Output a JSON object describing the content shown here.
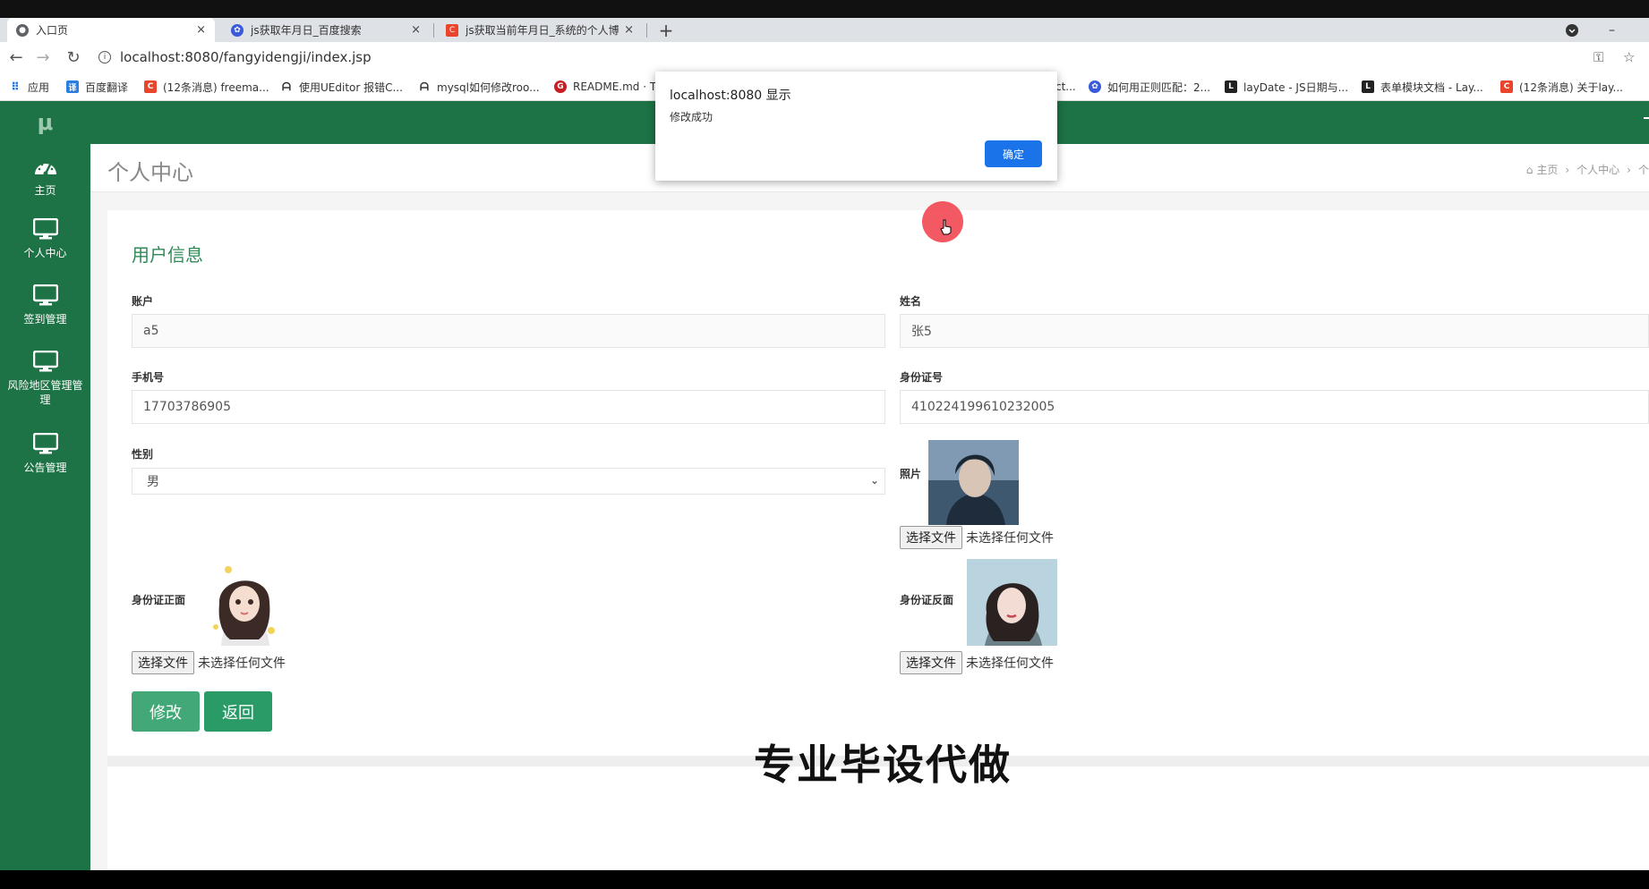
{
  "browser": {
    "tabs": [
      {
        "title": "入口页",
        "icon": "globe-icon",
        "close": "×"
      },
      {
        "title": "js获取年月日_百度搜索",
        "icon": "baidu-paw-icon",
        "close": "×"
      },
      {
        "title": "js获取当前年月日_系统的个人博",
        "icon": "csdn-icon",
        "close": "×"
      }
    ],
    "new_tab": "+",
    "url": "localhost:8080/fangyidengji/index.jsp",
    "bookmarks": [
      {
        "label": "应用",
        "icon": "apps-grid-icon"
      },
      {
        "label": "百度翻译",
        "icon": "translate-icon"
      },
      {
        "label": "(12条消息) freema...",
        "icon": "csdn-icon"
      },
      {
        "label": "使用UEditor 报错C...",
        "icon": "github-icon"
      },
      {
        "label": "mysql如何修改roo...",
        "icon": "github-icon"
      },
      {
        "label": "README.md · T",
        "icon": "gitee-icon"
      },
      {
        "label": "ct...",
        "icon": "link-icon"
      },
      {
        "label": "如何用正则匹配：2...",
        "icon": "baidu-paw-icon"
      },
      {
        "label": "layDate - JS日期与...",
        "icon": "layui-icon"
      },
      {
        "label": "表单模块文档 - Lay...",
        "icon": "layui-icon"
      },
      {
        "label": "(12条消息) 关于lay...",
        "icon": "csdn-icon"
      }
    ]
  },
  "app": {
    "logo": "μ",
    "sidebar": [
      {
        "label": "主页",
        "icon": "dashboard-gauge-icon"
      },
      {
        "label": "个人中心",
        "icon": "monitor-icon"
      },
      {
        "label": "签到管理",
        "icon": "monitor-icon"
      },
      {
        "label": "风险地区管理管理",
        "icon": "monitor-icon"
      },
      {
        "label": "公告管理",
        "icon": "monitor-icon"
      }
    ],
    "page_title": "个人中心",
    "breadcrumb": [
      "主页",
      "个人中心",
      "个"
    ],
    "section_title": "用户信息",
    "form": {
      "account_label": "账户",
      "account_value": "a5",
      "name_label": "姓名",
      "name_value": "张5",
      "phone_label": "手机号",
      "phone_value": "17703786905",
      "idno_label": "身份证号",
      "idno_value": "410224199610232005",
      "gender_label": "性别",
      "gender_value": "男",
      "photo_label": "照片",
      "id_front_label": "身份证正面",
      "id_back_label": "身份证反面",
      "file_button": "选择文件",
      "file_status": "未选择任何文件",
      "submit": "修改",
      "back": "返回"
    },
    "watermark": "专业毕设代做"
  },
  "dialog": {
    "title": "localhost:8080 显示",
    "message": "修改成功",
    "ok": "确定"
  },
  "colors": {
    "sidebar": "#1d7345",
    "section_title": "#2e8b57",
    "button_primary": "#38a36b",
    "dialog_ok": "#1a73e8"
  }
}
